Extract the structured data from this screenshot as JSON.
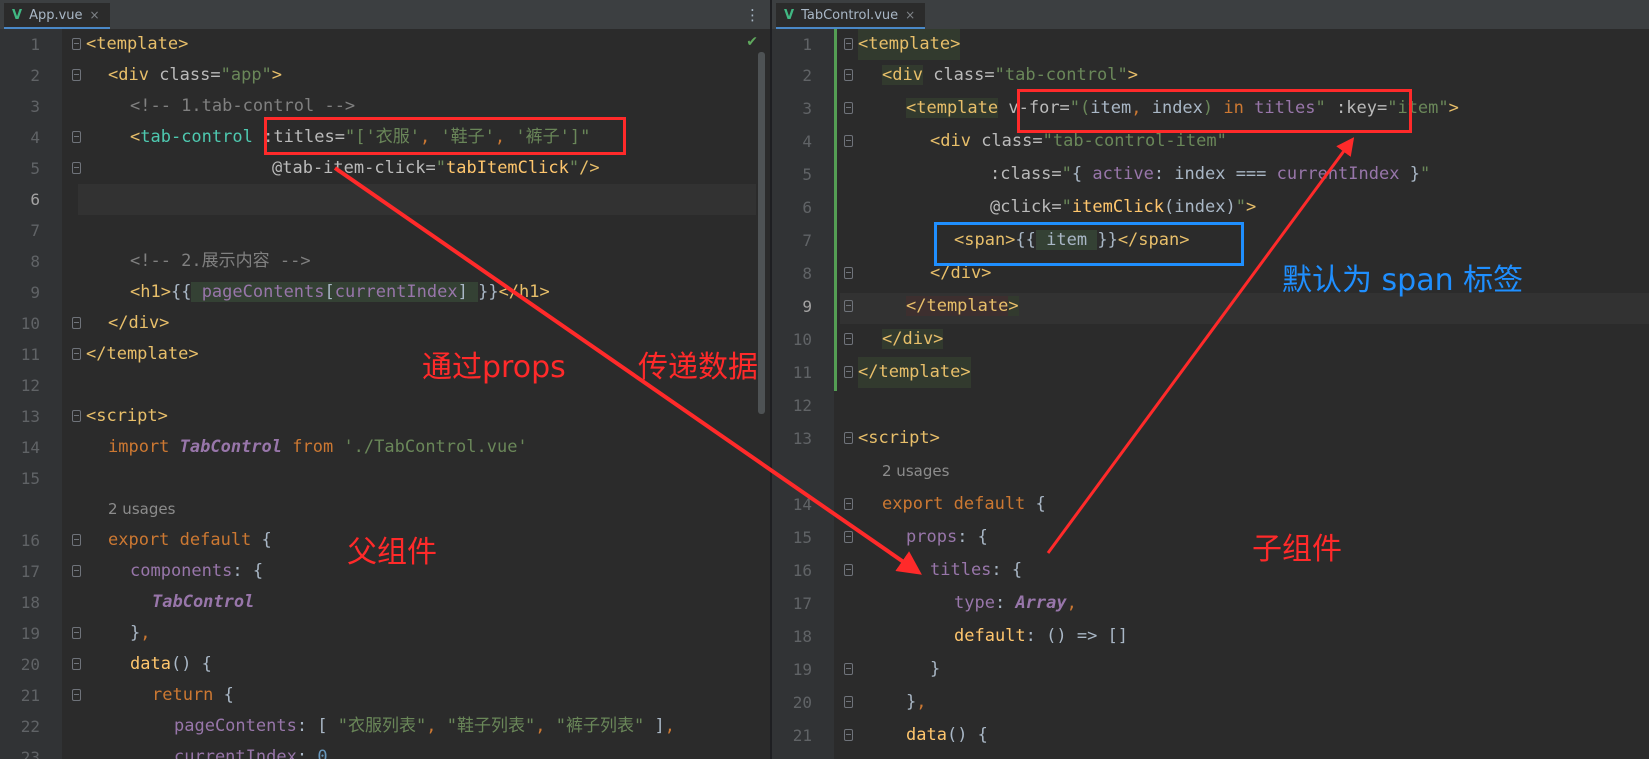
{
  "left_editor": {
    "tab": {
      "icon": "V",
      "label": "App.vue",
      "close": "×"
    },
    "menu_icon": "⋮",
    "status_icon": "✔",
    "lines": [
      {
        "n": "1"
      },
      {
        "n": "2"
      },
      {
        "n": "3"
      },
      {
        "n": "4"
      },
      {
        "n": "5"
      },
      {
        "n": "6"
      },
      {
        "n": "7"
      },
      {
        "n": "8"
      },
      {
        "n": "9"
      },
      {
        "n": "10"
      },
      {
        "n": "11"
      },
      {
        "n": "12"
      },
      {
        "n": "13"
      },
      {
        "n": "14"
      },
      {
        "n": "15"
      },
      {
        "n": "16"
      },
      {
        "n": "17"
      },
      {
        "n": "18"
      },
      {
        "n": "19"
      },
      {
        "n": "20"
      },
      {
        "n": "21"
      },
      {
        "n": "22"
      },
      {
        "n": "23"
      }
    ],
    "usages": "2 usages"
  },
  "right_editor": {
    "tab": {
      "icon": "V",
      "label": "TabControl.vue",
      "close": "×"
    },
    "lines": [
      {
        "n": "1"
      },
      {
        "n": "2"
      },
      {
        "n": "3"
      },
      {
        "n": "4"
      },
      {
        "n": "5"
      },
      {
        "n": "6"
      },
      {
        "n": "7"
      },
      {
        "n": "8"
      },
      {
        "n": "9"
      },
      {
        "n": "10"
      },
      {
        "n": "11"
      },
      {
        "n": "12"
      },
      {
        "n": "13"
      },
      {
        "n": "14"
      },
      {
        "n": "15"
      },
      {
        "n": "16"
      },
      {
        "n": "17"
      },
      {
        "n": "18"
      },
      {
        "n": "19"
      },
      {
        "n": "20"
      },
      {
        "n": "21"
      }
    ],
    "usages": "2 usages"
  },
  "annotations": {
    "props_label": "通过props",
    "pass_data_label": "传递数据",
    "parent_label": "父组件",
    "child_label": "子组件",
    "default_span_label": "默认为 span  标签"
  },
  "colors": {
    "annotation_red": "#ff2a2a",
    "annotation_blue": "#1f8fff",
    "editor_bg": "#2b2b2b"
  }
}
